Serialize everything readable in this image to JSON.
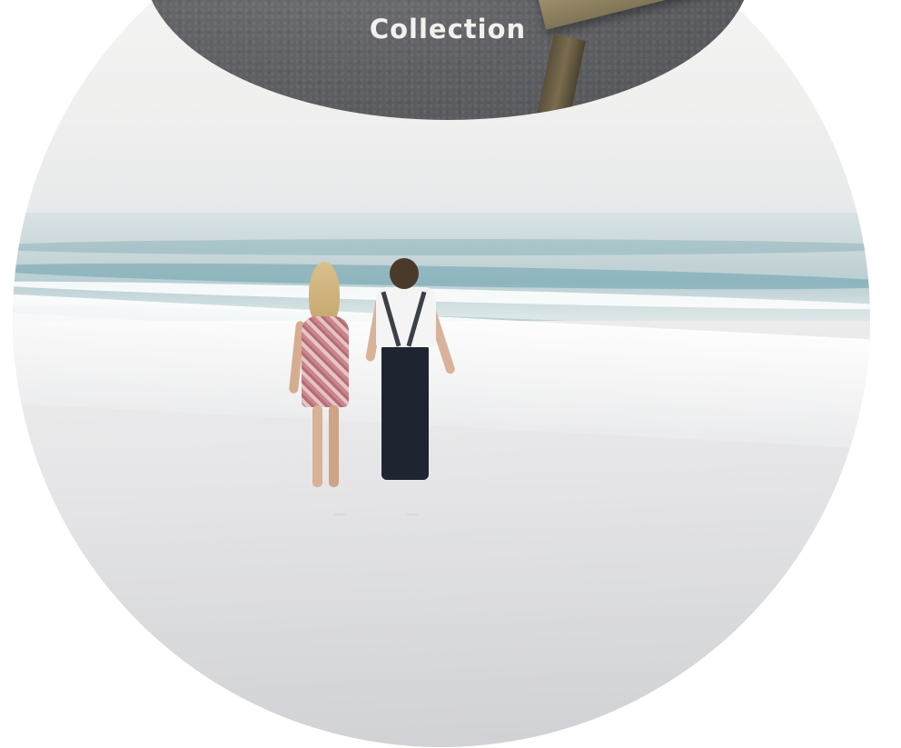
{
  "collection_badge": {
    "title": "Collection"
  },
  "colors": {
    "badge_background": "#626367",
    "badge_text": "#f2f1ee",
    "sea_accent": "#5a96a5",
    "sand": "#e6e6e8",
    "page_background": "#ffffff"
  }
}
